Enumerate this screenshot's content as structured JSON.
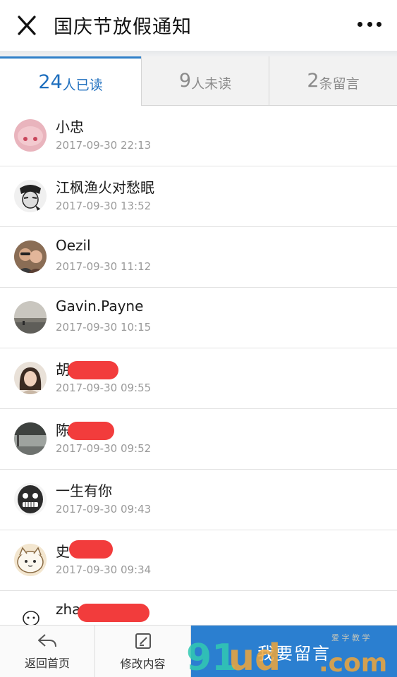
{
  "header": {
    "title": "国庆节放假通知",
    "close_icon": "close-icon",
    "more_icon": "more-dots-icon"
  },
  "tabs": [
    {
      "count": "24",
      "label": "人已读",
      "active": true
    },
    {
      "count": "9",
      "label": "人未读",
      "active": false
    },
    {
      "count": "2",
      "label": "条留言",
      "active": false
    }
  ],
  "readers": [
    {
      "name": "小忠",
      "time": "2017-09-30 22:13",
      "avatar": "pink-avatar",
      "redacted": false
    },
    {
      "name": "江枫渔火对愁眠",
      "time": "2017-09-30 13:52",
      "avatar": "sketch-avatar",
      "redacted": false
    },
    {
      "name": "Oezil",
      "time": "2017-09-30 11:12",
      "avatar": "couple-avatar",
      "redacted": false
    },
    {
      "name": "Gavin.Payne",
      "time": "2017-09-30 10:15",
      "avatar": "lake-avatar",
      "redacted": false
    },
    {
      "name": "胡",
      "time": "2017-09-30 09:55",
      "avatar": "girl-avatar",
      "redacted": true
    },
    {
      "name": "陈",
      "time": "2017-09-30 09:52",
      "avatar": "street-avatar",
      "redacted": true
    },
    {
      "name": "一生有你",
      "time": "2017-09-30 09:43",
      "avatar": "cartoon-face-avatar",
      "redacted": false
    },
    {
      "name": "史",
      "time": "2017-09-30 09:34",
      "avatar": "cat-avatar",
      "redacted": true
    },
    {
      "name": "zha",
      "time": "",
      "avatar": "doodle-avatar",
      "redacted": true
    }
  ],
  "bottom_bar": {
    "home_label": "返回首页",
    "edit_label": "修改内容",
    "comment_label": "我要留言"
  },
  "watermark": {
    "text": "91ud.com",
    "small": "爱 字 教 学"
  },
  "colors": {
    "accent": "#2b7fd0",
    "tab_active_text": "#1f6fbe",
    "redaction": "#f23c3c"
  }
}
